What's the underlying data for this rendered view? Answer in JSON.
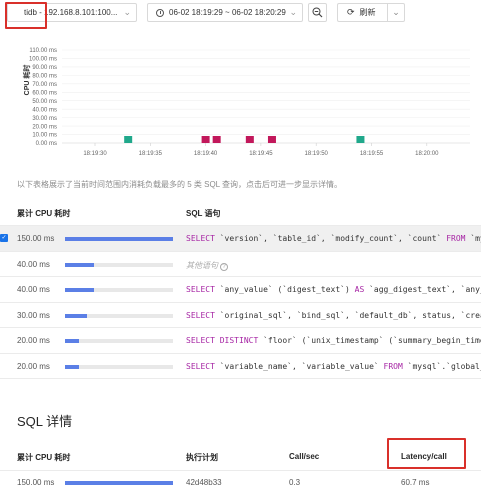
{
  "toolbar": {
    "instance": "tidb - 192.168.8.101:100...",
    "range": "06-02 18:19:29 ~ 06-02 18:20:29",
    "refresh": "刷新"
  },
  "chart_data": {
    "type": "scatter",
    "ylabel": "CPU 耗时",
    "y_unit": "ms",
    "ylim": [
      0,
      110
    ],
    "y_ticks": [
      "110.00 ms",
      "100.00 ms",
      "90.00 ms",
      "80.00 ms",
      "70.00 ms",
      "60.00 ms",
      "50.00 ms",
      "40.00 ms",
      "30.00 ms",
      "20.00 ms",
      "10.00 ms",
      "0.00 ms"
    ],
    "x_ticks": [
      "18:19:30",
      "18:19:35",
      "18:19:40",
      "18:19:45",
      "18:19:50",
      "18:19:55",
      "18:20:00"
    ],
    "points": [
      {
        "x": "18:19:33",
        "y": 0,
        "color": "#20a88b"
      },
      {
        "x": "18:19:40",
        "y": 0,
        "color": "#c2185b"
      },
      {
        "x": "18:19:41",
        "y": 0,
        "color": "#c2185b"
      },
      {
        "x": "18:19:44",
        "y": 0,
        "color": "#c2185b"
      },
      {
        "x": "18:19:46",
        "y": 0,
        "color": "#c2185b"
      },
      {
        "x": "18:19:54",
        "y": 0,
        "color": "#20a88b"
      }
    ]
  },
  "note": "以下表格展示了当前时间范围内消耗负载最多的 5 类 SQL 查询，点击后可进一步显示详情。",
  "top_table": {
    "headers": {
      "cpu": "累计 CPU 耗时",
      "sql": "SQL 语句"
    },
    "rows": [
      {
        "value": "150.00 ms",
        "pct": 1.0,
        "sql": "SELECT `version`, `table_id`, `modify_count`, `count` FROM `mysql`",
        "selected": true
      },
      {
        "value": "40.00 ms",
        "pct": 0.27,
        "other": "其他语句"
      },
      {
        "value": "40.00 ms",
        "pct": 0.27,
        "sql": "SELECT `any_value` (`digest_text`) AS `agg_digest_text`, `any_va"
      },
      {
        "value": "30.00 ms",
        "pct": 0.2,
        "sql": "SELECT `original_sql`, `bind_sql`, `default_db`, status, `create"
      },
      {
        "value": "20.00 ms",
        "pct": 0.13,
        "sql": "SELECT DISTINCT `floor` (`unix_timestamp` (`summary_begin_time`)"
      },
      {
        "value": "20.00 ms",
        "pct": 0.13,
        "sql": "SELECT `variable_name`, `variable_value` FROM `mysql`.`global_va"
      }
    ]
  },
  "detail": {
    "title": "SQL 详情",
    "headers": {
      "cpu": "累计 CPU 耗时",
      "plan": "执行计划",
      "calls": "Call/sec",
      "latency": "Latency/call"
    },
    "row": {
      "cpu": "150.00 ms",
      "pct": 1.0,
      "plan": "42d48b33",
      "calls": "0.3",
      "latency": "60.7 ms"
    }
  }
}
